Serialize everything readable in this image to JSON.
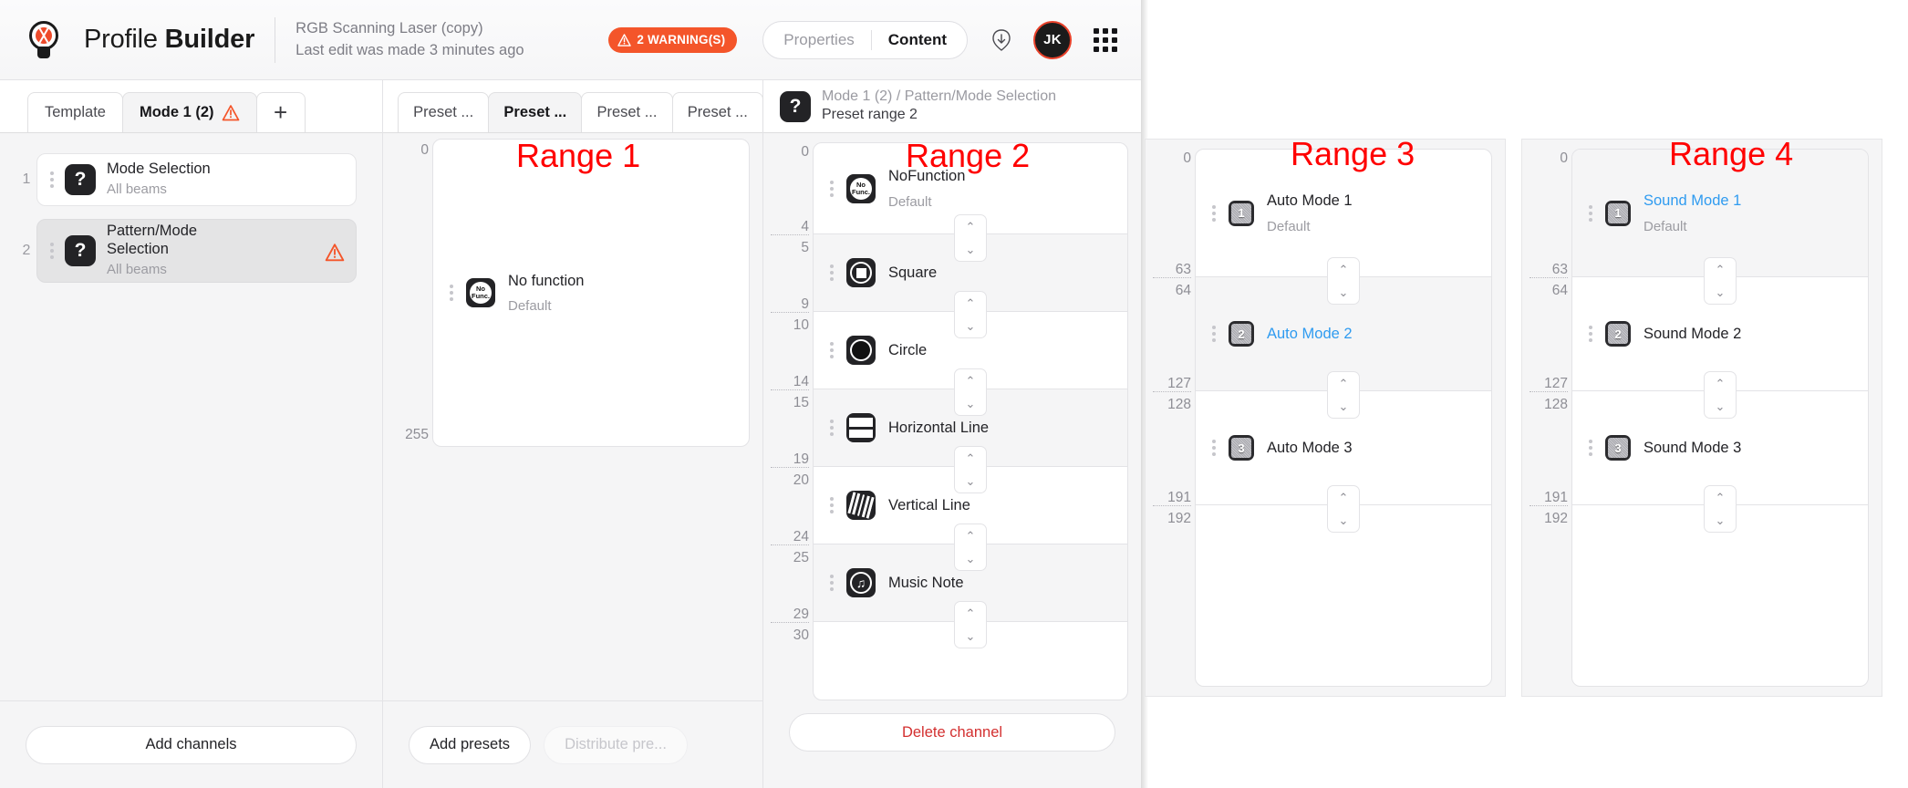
{
  "header": {
    "title_light": "Profile ",
    "title_bold": "Builder",
    "doc_name": "RGB Scanning Laser (copy)",
    "doc_edit": "Last edit was made 3 minutes ago",
    "warning_badge": "2 WARNING(S)",
    "warning_icon": "warning-triangle-icon",
    "seg_properties": "Properties",
    "seg_content": "Content",
    "download_icon": "download-icon",
    "avatar_initials": "JK",
    "apps_icon": "apps-grid-icon",
    "accent_warning": "#f4552a",
    "accent_link": "#2f9bf0",
    "accent_danger": "#d32f2f"
  },
  "channels_panel": {
    "tabs": [
      {
        "label": "Template",
        "active": false,
        "warn": false
      },
      {
        "label": "Mode 1 (2)",
        "active": true,
        "warn": true
      },
      {
        "label": "+",
        "active": false,
        "warn": false
      }
    ],
    "rows": [
      {
        "index": "1",
        "name": "Mode Selection",
        "sub": "All beams",
        "icon": "question-mark-icon",
        "selected": false,
        "warn": false
      },
      {
        "index": "2",
        "name": "Pattern/Mode Selection",
        "sub": "All beams",
        "icon": "question-mark-icon",
        "selected": true,
        "warn": true
      }
    ],
    "add_button": "Add channels"
  },
  "presets_panel": {
    "tabs": [
      {
        "label": "Preset ...",
        "active": false
      },
      {
        "label": "Preset ...",
        "active": true
      },
      {
        "label": "Preset ...",
        "active": false
      },
      {
        "label": "Preset ...",
        "active": false
      }
    ],
    "add_button": "Add presets",
    "distribute_button": "Distribute pre...",
    "range_label": "Range 1",
    "scale": [
      "0",
      "255"
    ],
    "item": {
      "title": "No function",
      "sub": "Default",
      "icon": "no-function-icon",
      "icon_text_line1": "No",
      "icon_text_line2": "Func."
    }
  },
  "detail_panel": {
    "breadcrumb": "Mode 1 (2)  /  Pattern/Mode Selection",
    "subtitle": "Preset range 2",
    "icon": "question-mark-icon",
    "range_label": "Range 2",
    "delete_button": "Delete channel",
    "rows": [
      {
        "from": "0",
        "to": "4",
        "title": "NoFunction",
        "sub": "Default",
        "icon": "no-function-icon",
        "alt": false,
        "link": false
      },
      {
        "from": "5",
        "to": "9",
        "title": "Square",
        "sub": "",
        "icon": "square-shape-icon",
        "alt": true,
        "link": false
      },
      {
        "from": "10",
        "to": "14",
        "title": "Circle",
        "sub": "",
        "icon": "circle-shape-icon",
        "alt": false,
        "link": false
      },
      {
        "from": "15",
        "to": "19",
        "title": "Horizontal Line",
        "sub": "",
        "icon": "horizontal-line-icon",
        "alt": true,
        "link": false
      },
      {
        "from": "20",
        "to": "24",
        "title": "Vertical Line",
        "sub": "",
        "icon": "vertical-line-icon",
        "alt": false,
        "link": false
      },
      {
        "from": "25",
        "to": "29",
        "title": "Music Note",
        "sub": "",
        "icon": "music-note-icon",
        "alt": true,
        "link": false
      },
      {
        "from": "30",
        "to": "",
        "title": "",
        "sub": "",
        "icon": "",
        "alt": false,
        "link": false
      }
    ]
  },
  "range3": {
    "label": "Range 3",
    "rows": [
      {
        "from": "0",
        "to": "63",
        "title": "Auto Mode 1",
        "sub": "Default",
        "badge": "1",
        "alt": false,
        "link": false
      },
      {
        "from": "64",
        "to": "127",
        "title": "Auto Mode 2",
        "sub": "",
        "badge": "2",
        "alt": true,
        "link": true
      },
      {
        "from": "128",
        "to": "191",
        "title": "Auto Mode 3",
        "sub": "",
        "badge": "3",
        "alt": false,
        "link": false
      },
      {
        "from": "192",
        "to": "",
        "title": "",
        "sub": "",
        "badge": "",
        "alt": false,
        "link": false
      }
    ]
  },
  "range4": {
    "label": "Range 4",
    "rows": [
      {
        "from": "0",
        "to": "63",
        "title": "Sound Mode 1",
        "sub": "Default",
        "badge": "1",
        "alt": true,
        "link": true
      },
      {
        "from": "64",
        "to": "127",
        "title": "Sound Mode 2",
        "sub": "",
        "badge": "2",
        "alt": false,
        "link": false
      },
      {
        "from": "128",
        "to": "191",
        "title": "Sound Mode 3",
        "sub": "",
        "badge": "3",
        "alt": false,
        "link": false
      },
      {
        "from": "192",
        "to": "",
        "title": "",
        "sub": "",
        "badge": "",
        "alt": false,
        "link": false
      }
    ]
  }
}
